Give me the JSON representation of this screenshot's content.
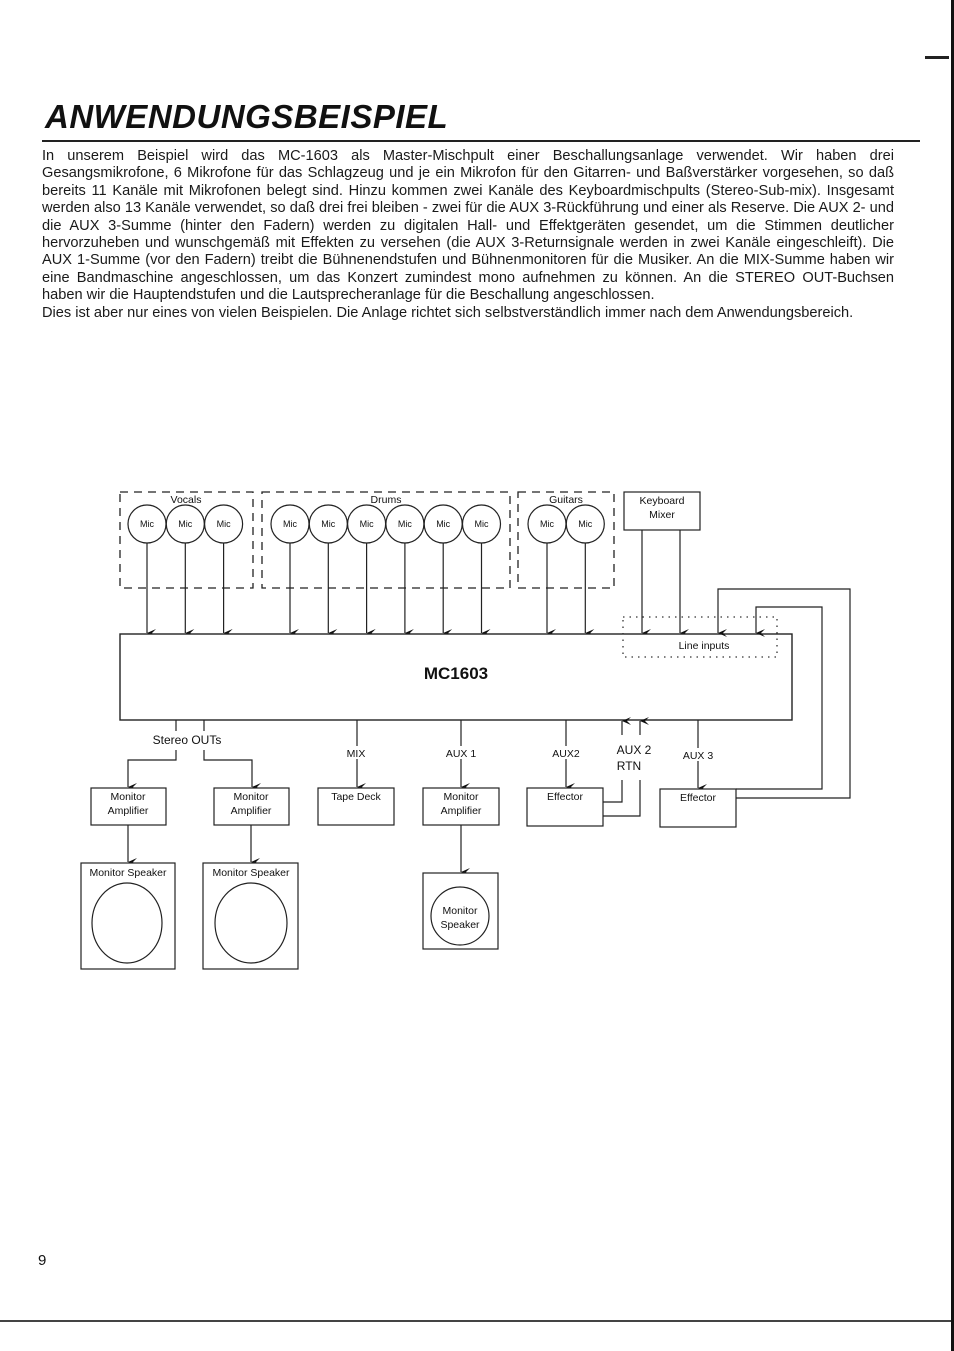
{
  "page": {
    "title": "ANWENDUNGSBEISPIEL",
    "page_number": "9",
    "paragraphs": [
      "In unserem Beispiel wird das MC-1603 als Master-Mischpult einer Beschallungsanlage verwendet. Wir haben drei Gesangsmikrofone, 6 Mikrofone für das Schlagzeug und je ein Mikrofon für den Gitarren- und Baßverstärker vorgesehen, so daß bereits 11 Kanäle mit Mikrofonen belegt sind. Hinzu kommen zwei Kanäle des Keyboardmischpults (Stereo-Sub-mix). Insgesamt werden also 13 Kanäle verwendet, so daß drei frei bleiben - zwei für die AUX 3-Rückführung und einer als Reserve. Die AUX 2- und die AUX 3-Summe (hinter den Fadern) werden zu digitalen Hall- und Effektgeräten gesendet, um die Stimmen deutlicher hervorzuheben und wunschgemäß mit Effekten zu versehen (die AUX 3-Returnsignale werden in zwei Kanäle eingeschleift). Die AUX 1-Summe (vor den Fadern) treibt die Bühnenendstufen und Bühnenmonitoren für die Musiker. An die MIX-Summe haben wir eine Bandmaschine angeschlossen, um das Konzert zumindest mono aufnehmen zu können. An die STEREO OUT-Buchsen haben wir die Hauptendstufen und die Lautsprecheranlage für die Beschallung angeschlossen.",
      "Dies ist aber nur eines von vielen Beispielen. Die Anlage richtet sich selbstverständlich immer nach dem Anwendungsbereich."
    ]
  },
  "diagram": {
    "mic_label": "Mic",
    "groups": [
      {
        "name": "Vocals",
        "mic_count": 3
      },
      {
        "name": "Drums",
        "mic_count": 6
      },
      {
        "name": "Guitars",
        "mic_count": 2
      }
    ],
    "keyboard_mixer": [
      "Keyboard",
      "Mixer"
    ],
    "mixer_name": "MC1603",
    "line_inputs_label": "Line inputs",
    "stereo_outs_label": "Stereo OUTs",
    "outputs": {
      "mix": "MIX",
      "aux1": "AUX 1",
      "aux2": "AUX2",
      "aux2_rtn": [
        "AUX 2",
        "RTN"
      ],
      "aux3": "AUX 3"
    },
    "devices": {
      "monitor_amp": [
        "Monitor",
        "Amplifier"
      ],
      "tape_deck": "Tape Deck",
      "effector": "Effector",
      "monitor_speaker": "Monitor Speaker",
      "monitor_speaker_round": [
        "Monitor",
        "Speaker"
      ]
    }
  }
}
